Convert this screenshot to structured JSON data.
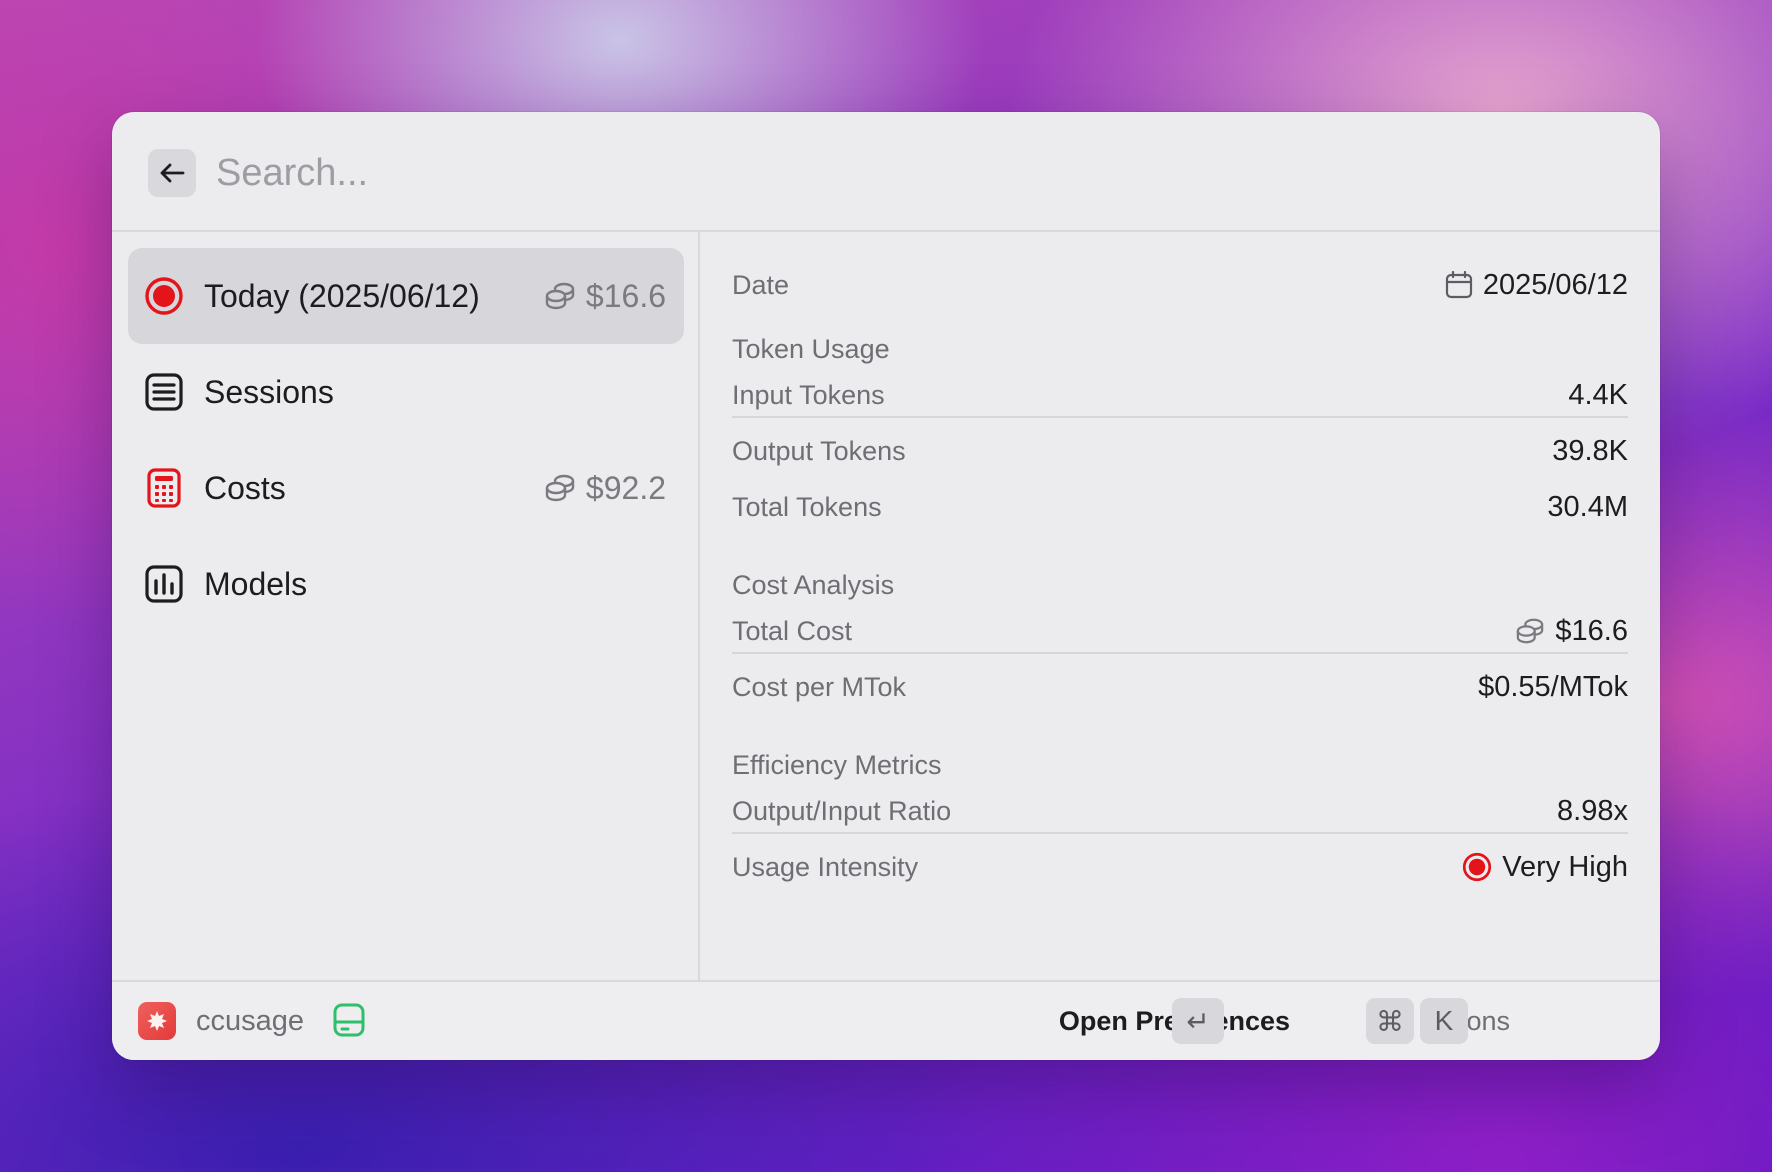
{
  "search": {
    "placeholder": "Search..."
  },
  "list": {
    "items": [
      {
        "label": "Today (2025/06/12)",
        "accessory": "$16.6",
        "icon": "record-icon",
        "selected": true
      },
      {
        "label": "Sessions",
        "accessory": "",
        "icon": "list-icon",
        "selected": false
      },
      {
        "label": "Costs",
        "accessory": "$92.2",
        "icon": "calculator-icon",
        "selected": false
      },
      {
        "label": "Models",
        "accessory": "",
        "icon": "bar-chart-icon",
        "selected": false
      }
    ]
  },
  "detail": {
    "date": {
      "label": "Date",
      "value": "2025/06/12"
    },
    "token_usage": {
      "title": "Token Usage",
      "input": {
        "label": "Input Tokens",
        "value": "4.4K"
      },
      "output": {
        "label": "Output Tokens",
        "value": "39.8K"
      },
      "total": {
        "label": "Total Tokens",
        "value": "30.4M"
      }
    },
    "cost_analysis": {
      "title": "Cost Analysis",
      "total_cost": {
        "label": "Total Cost",
        "value": "$16.6"
      },
      "cost_per_mtok": {
        "label": "Cost per MTok",
        "value": "$0.55/MTok"
      }
    },
    "efficiency": {
      "title": "Efficiency Metrics",
      "ratio": {
        "label": "Output/Input Ratio",
        "value": "8.98x"
      },
      "intensity": {
        "label": "Usage Intensity",
        "value": "Very High"
      }
    }
  },
  "footer": {
    "app_name": "ccusage",
    "primary_action": "Open Preferences",
    "enter_key": "↵",
    "actions_label": "Actions",
    "cmd_key": "⌘",
    "k_key": "K"
  },
  "colors": {
    "accent_red": "#e4141b",
    "drive_green": "#2fbf6a",
    "window_bg": "#ecebee"
  }
}
